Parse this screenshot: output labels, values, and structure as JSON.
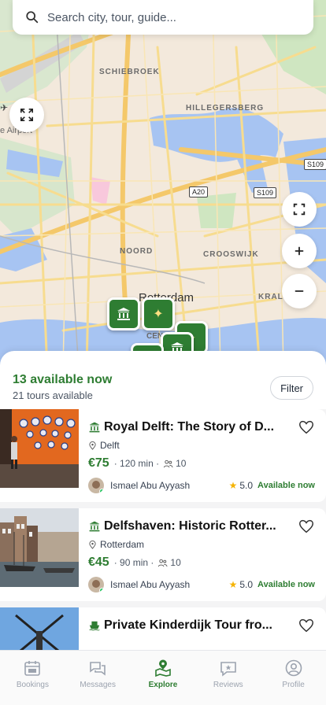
{
  "search": {
    "placeholder": "Search city, tour, guide..."
  },
  "map": {
    "labels": {
      "schiebroek": "SCHIEBROEK",
      "hillegersberg": "HILLEGERSBERG",
      "noord": "NOORD",
      "crooswijk": "CROOSWIJK",
      "kralingen": "KRALI",
      "city": "Rotterdam",
      "centrum": "CEN",
      "airport": "e Airport"
    },
    "road_shields": {
      "s109_top": "S109",
      "a20": "A20",
      "s109": "S109"
    },
    "colors": {
      "land": "#f3e9dc",
      "water": "#a7c4f2",
      "park": "#cfe6c1",
      "road": "#f7d07a"
    }
  },
  "sheet": {
    "title": "13 available now",
    "subtitle": "21 tours available",
    "filter_label": "Filter"
  },
  "tours": [
    {
      "title": "Royal Delft: The Story of D...",
      "location": "Delft",
      "price": "€75",
      "duration": "120 min",
      "group_size": "10",
      "guide": "Ismael Abu Ayyash",
      "rating": "5.0",
      "status": "Available now",
      "category_icon": "museum-icon"
    },
    {
      "title": "Delfshaven: Historic Rotter...",
      "location": "Rotterdam",
      "price": "€45",
      "duration": "90 min",
      "group_size": "10",
      "guide": "Ismael Abu Ayyash",
      "rating": "5.0",
      "status": "Available now",
      "category_icon": "museum-icon"
    },
    {
      "title": "Private Kinderdijk Tour fro...",
      "category_icon": "boat-icon"
    }
  ],
  "nav": [
    {
      "label": "Bookings",
      "icon": "calendar-icon"
    },
    {
      "label": "Messages",
      "icon": "chat-icon"
    },
    {
      "label": "Explore",
      "icon": "map-pin-icon",
      "active": true
    },
    {
      "label": "Reviews",
      "icon": "review-icon"
    },
    {
      "label": "Profile",
      "icon": "profile-icon"
    }
  ],
  "colors": {
    "accent": "#2e7d32",
    "star": "#f5b301",
    "online": "#22c55e"
  }
}
